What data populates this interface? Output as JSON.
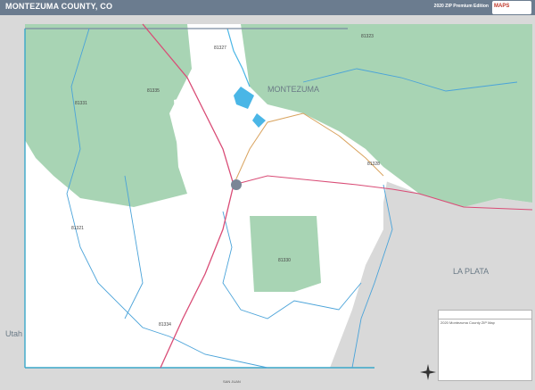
{
  "header": {
    "title": "MONTEZUMA COUNTY, CO",
    "edition": "2020 ZIP Premium Edition",
    "brand": "MAPS"
  },
  "map": {
    "county_label": "MONTEZUMA",
    "neighbor_la_plata": "LA PLATA",
    "neighbor_utah": "Utah",
    "zip_labels": [
      "81323",
      "81327",
      "81335",
      "81331",
      "81328",
      "81321",
      "81330",
      "81334"
    ],
    "border_label_bottom": "SAN JUAN",
    "colors": {
      "zip_green": "#a8d4b4",
      "county_white": "#ffffff",
      "outside_gray": "#d9d9d9",
      "water_blue": "#4ab6e6",
      "boundary_teal": "#3aa7c9",
      "road_red": "#d94c76",
      "road_orange": "#d9a35f",
      "zip_boundary_blue": "#4aa3d9",
      "header_bg": "#6b7c8f"
    },
    "icons": [
      "compass-rose-icon"
    ]
  },
  "legend": {
    "title": "2020 Montezuma County ZIP Map"
  }
}
